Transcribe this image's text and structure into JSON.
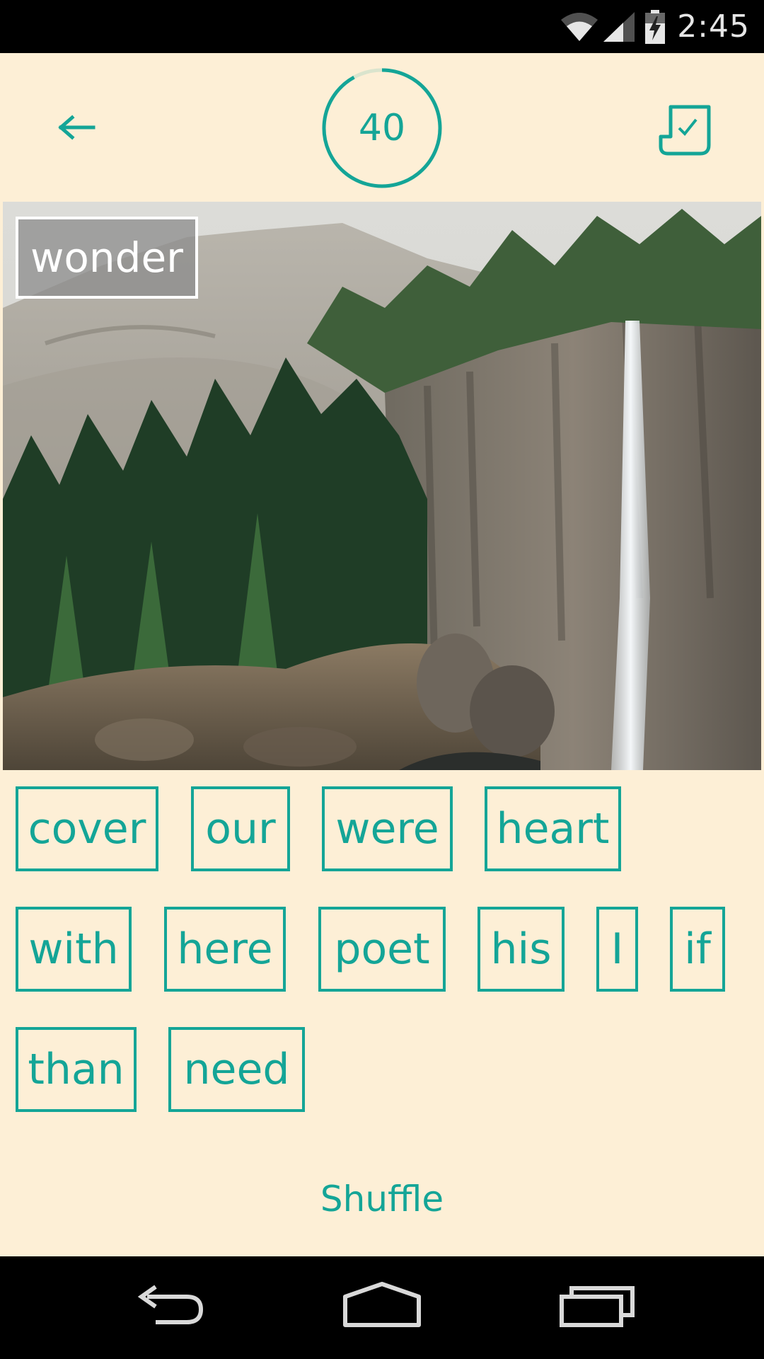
{
  "status_bar": {
    "time": "2:45",
    "icons": [
      "wifi-icon",
      "signal-icon",
      "battery-charging-icon"
    ]
  },
  "header": {
    "back_icon": "arrow-left-icon",
    "timer_value": "40",
    "timer_progress": 0.92,
    "submit_icon": "poem-check-icon"
  },
  "photo": {
    "placed_word": "wonder"
  },
  "word_bank": {
    "row1": [
      "cover",
      "our",
      "were",
      "heart"
    ],
    "row2": [
      "with",
      "here",
      "poet",
      "his",
      "I",
      "if"
    ],
    "row3": [
      "than",
      "need"
    ]
  },
  "shuffle_label": "Shuffle",
  "nav_bar": {
    "icons": [
      "nav-back-icon",
      "nav-home-icon",
      "nav-recents-icon"
    ]
  },
  "colors": {
    "background": "#FDEFD6",
    "accent": "#14A597",
    "bar": "#000000"
  }
}
